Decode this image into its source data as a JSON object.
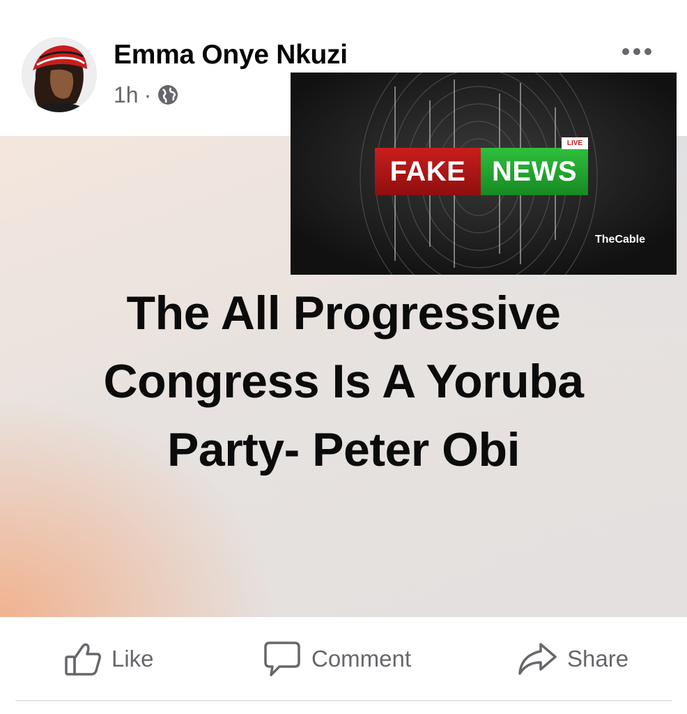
{
  "post": {
    "author": "Emma Onye Nkuzi",
    "time": "1h",
    "separator": "·",
    "privacy_icon": "globe-icon",
    "more_icon": "more-dots-icon",
    "headline_lines": [
      "The All Progressive",
      "Congress Is A Yoruba",
      "Party- Peter Obi"
    ]
  },
  "overlay": {
    "badge_fake": "FAKE",
    "badge_news": "NEWS",
    "badge_live": "LIVE",
    "logo": "TheCable"
  },
  "actions": {
    "like": "Like",
    "comment": "Comment",
    "share": "Share"
  },
  "colors": {
    "fake_red": "#c91d1d",
    "news_green": "#2fbf3d",
    "secondary_text": "#65676b"
  }
}
